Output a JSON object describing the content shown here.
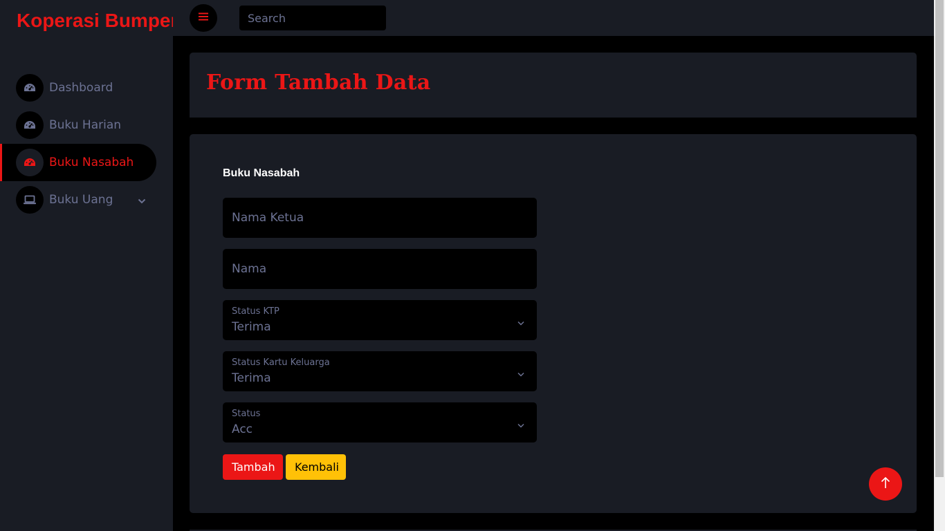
{
  "brand": "Koperasi Bumper",
  "search": {
    "placeholder": "Search"
  },
  "sidebar": {
    "items": [
      {
        "label": "Dashboard",
        "icon": "tachometer-icon",
        "active": false
      },
      {
        "label": "Buku Harian",
        "icon": "tachometer-icon",
        "active": false
      },
      {
        "label": "Buku Nasabah",
        "icon": "tachometer-icon",
        "active": true
      },
      {
        "label": "Buku Uang",
        "icon": "laptop-icon",
        "active": false,
        "has_dropdown": true
      }
    ]
  },
  "page": {
    "title": "Form Tambah Data"
  },
  "form": {
    "heading": "Buku Nasabah",
    "nama_ketua_placeholder": "Nama Ketua",
    "nama_placeholder": "Nama",
    "status_ktp": {
      "label": "Status KTP",
      "value": "Terima"
    },
    "status_kk": {
      "label": "Status Kartu Keluarga",
      "value": "Terima"
    },
    "status": {
      "label": "Status",
      "value": "Acc"
    },
    "submit_label": "Tambah",
    "back_label": "Kembali"
  },
  "colors": {
    "accent": "#eb1616",
    "warning": "#ffc107",
    "panel": "#191c24",
    "background": "#000000",
    "muted_text": "#6c7293"
  }
}
